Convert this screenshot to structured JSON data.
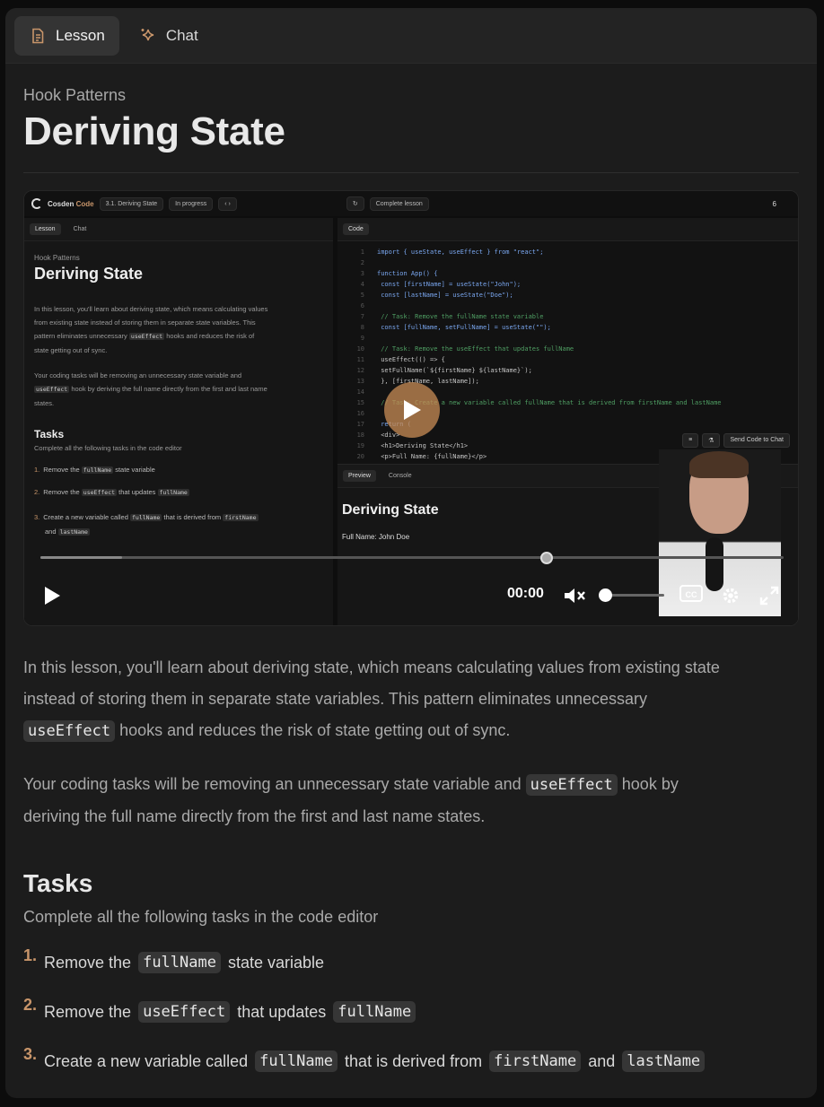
{
  "tabs": [
    {
      "label": "Lesson",
      "icon": "document-icon",
      "active": true
    },
    {
      "label": "Chat",
      "icon": "sparkles-icon",
      "active": false
    }
  ],
  "header": {
    "subtitle": "Hook Patterns",
    "title": "Deriving State"
  },
  "video": {
    "brand": "Cosden",
    "brand_accent": "Code",
    "lesson_chip": "3.1. Deriving State",
    "status_chip": "In progress",
    "complete_label": "Complete lesson",
    "streak": "6",
    "left_tabs": [
      "Lesson",
      "Chat"
    ],
    "left_subtitle": "Hook Patterns",
    "left_title": "Deriving State",
    "left_p1a": "In this lesson, you'll learn about deriving state, which means calculating values",
    "left_p1b": "from existing state instead of storing them in separate state variables. This",
    "left_p1c_pre": "pattern eliminates unnecessary",
    "left_p1c_code": "useEffect",
    "left_p1c_post": "hooks and reduces the risk of",
    "left_p1d": "state getting out of sync.",
    "left_p2a": "Your coding tasks will be removing an unnecessary state variable and",
    "left_p2b_code": "useEffect",
    "left_p2b_post": "hook by deriving the full name directly from the first and last name",
    "left_p2c": "states.",
    "left_tasks_title": "Tasks",
    "left_tasks_sub": "Complete all the following tasks in the code editor",
    "code_tab": "Code",
    "code_lines": [
      "import { useState, useEffect } from \"react\";",
      "",
      "function App() {",
      "  const [firstName] = useState(\"John\");",
      "  const [lastName] = useState(\"Doe\");",
      "",
      "  // Task: Remove the fullName state variable",
      "  const [fullName, setFullName] = useState(\"\");",
      "",
      "  // Task: Remove the useEffect that updates fullName",
      "  useEffect(() => {",
      "    setFullName(`${firstName} ${lastName}`);",
      "  }, [firstName, lastName]);",
      "",
      "  // Task: Create a new variable called fullName that is derived from firstName and lastName",
      "",
      "  return (",
      "    <div>",
      "      <h1>Deriving State</h1>",
      "      <p>Full Name: {fullName}</p>"
    ],
    "send_label": "Send Code to Chat",
    "preview_tabs": [
      "Preview",
      "Console"
    ],
    "preview_title": "Deriving State",
    "preview_text": "Full Name: John Doe",
    "time": "00:00",
    "progress_buffered": 0.11,
    "progress_played": 0.0
  },
  "body": {
    "p1_line1": "In this lesson, you'll learn about deriving state, which means calculating values from existing state",
    "p1_line2": "instead of storing them in separate state variables. This pattern eliminates unnecessary",
    "p1_code": "useEffect",
    "p1_line3": " hooks and reduces the risk of state getting out of sync.",
    "p2_pre": "Your coding tasks will be removing an unnecessary state variable and ",
    "p2_code": "useEffect",
    "p2_post": " hook by",
    "p2_line2": "deriving the full name directly from the first and last name states."
  },
  "tasks": {
    "title": "Tasks",
    "subtitle": "Complete all the following tasks in the code editor",
    "items": [
      {
        "num": "1.",
        "pre": "Remove the",
        "code1": "fullName",
        "mid": "state variable",
        "code2": "",
        "post": "",
        "code3": ""
      },
      {
        "num": "2.",
        "pre": "Remove the",
        "code1": "useEffect",
        "mid": "that updates",
        "code2": "fullName",
        "post": "",
        "code3": ""
      },
      {
        "num": "3.",
        "pre": "Create a new variable called",
        "code1": "fullName",
        "mid": "that is derived from",
        "code2": "firstName",
        "post": "and",
        "code3": "lastName"
      }
    ]
  }
}
